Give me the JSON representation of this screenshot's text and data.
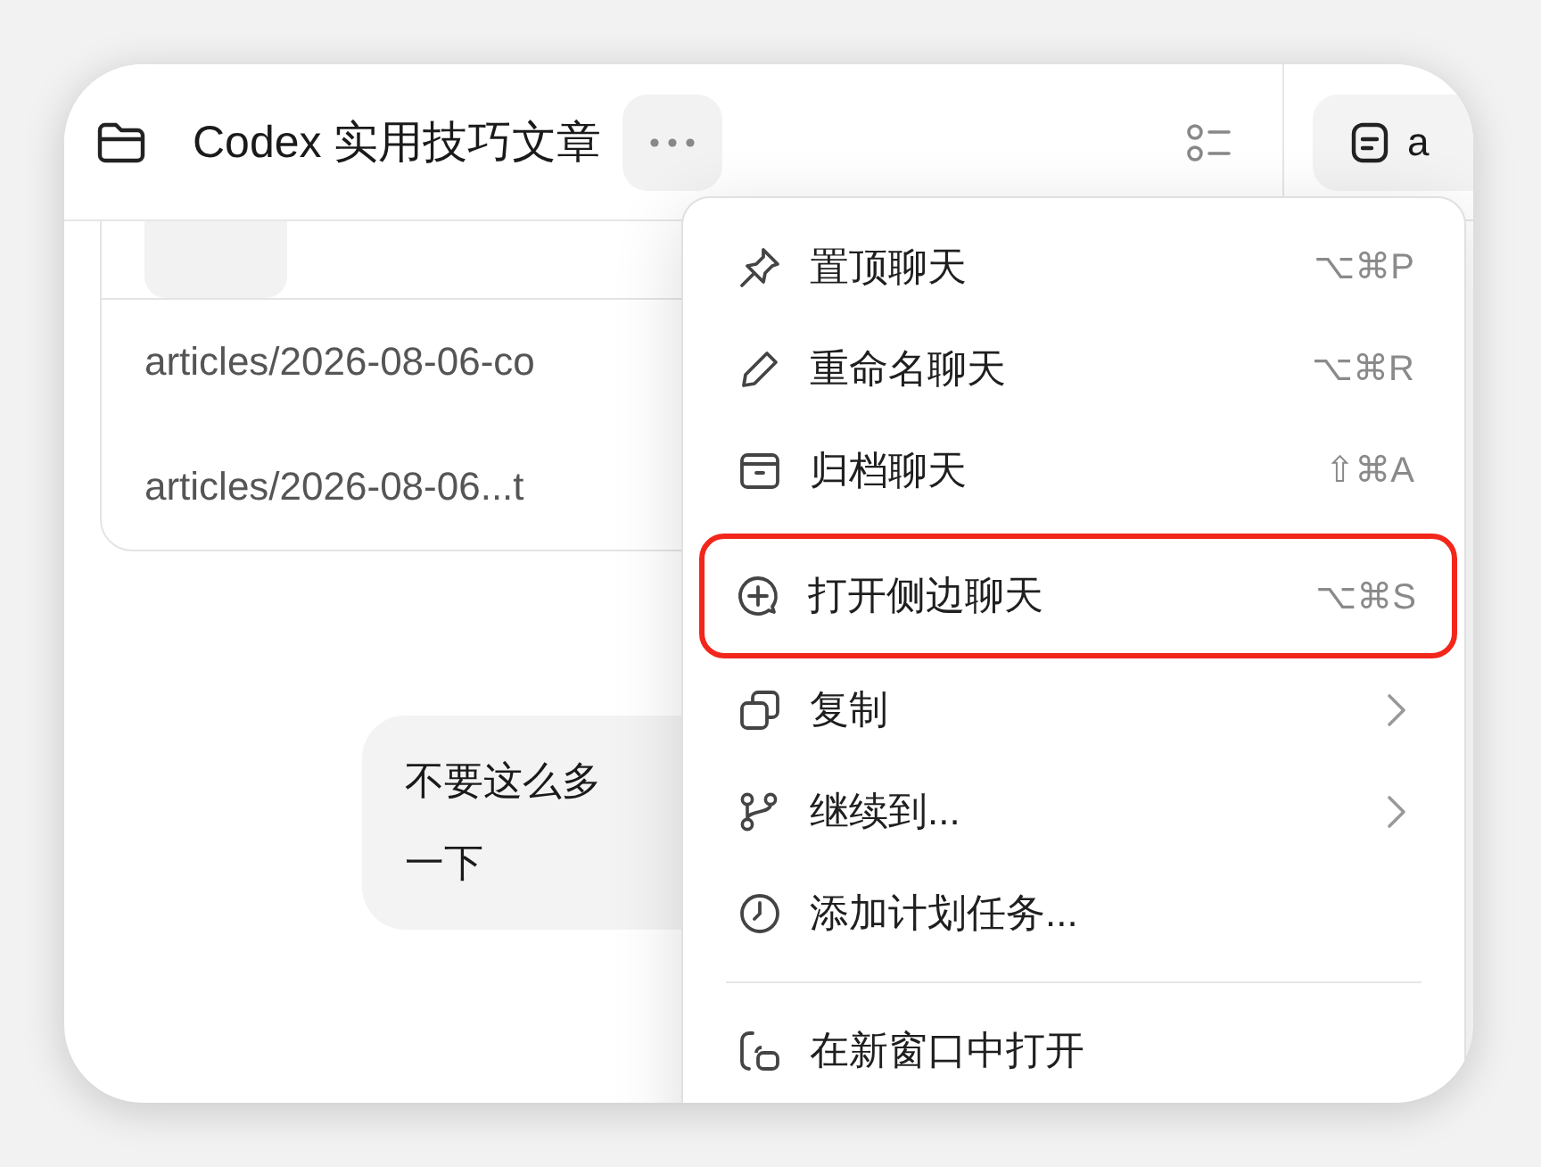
{
  "header": {
    "title": "Codex 实用技巧文章",
    "tab_label": "a"
  },
  "card": {
    "files": [
      "articles/2026-08-06-co",
      "articles/2026-08-06...t"
    ]
  },
  "message": {
    "lines": [
      "不要这么多",
      "一下"
    ]
  },
  "menu": {
    "items": [
      {
        "kind": "shortcut",
        "label": "置顶聊天",
        "shortcut": "⌥⌘P",
        "highlighted": false
      },
      {
        "kind": "shortcut",
        "label": "重命名聊天",
        "shortcut": "⌥⌘R",
        "highlighted": false
      },
      {
        "kind": "shortcut",
        "label": "归档聊天",
        "shortcut": "⇧⌘A",
        "highlighted": false
      },
      {
        "kind": "shortcut",
        "label": "打开侧边聊天",
        "shortcut": "⌥⌘S",
        "highlighted": true
      },
      {
        "kind": "submenu",
        "label": "复制",
        "highlighted": false
      },
      {
        "kind": "submenu",
        "label": "继续到...",
        "highlighted": false
      },
      {
        "kind": "plain",
        "label": "添加计划任务...",
        "highlighted": false
      },
      {
        "kind": "divider"
      },
      {
        "kind": "plain",
        "label": "在新窗口中打开",
        "highlighted": false
      }
    ]
  }
}
